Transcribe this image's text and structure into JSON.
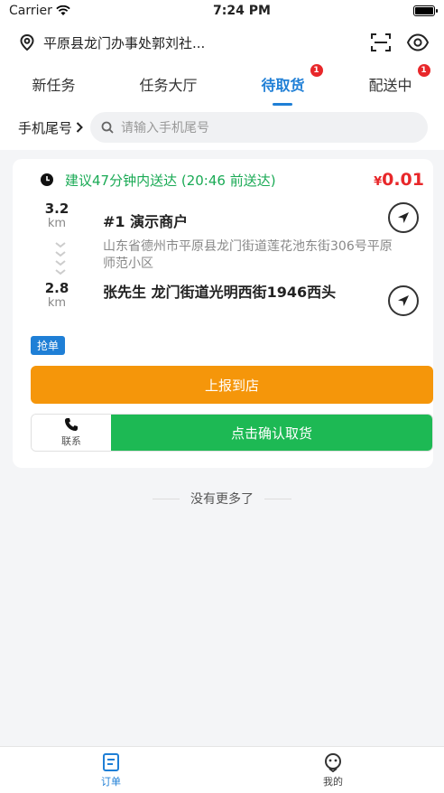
{
  "status_bar": {
    "carrier": "Carrier",
    "time": "7:24 PM"
  },
  "header": {
    "location": "平原县龙门办事处郭刘社...",
    "icons": [
      "location-pin-icon",
      "scan-icon",
      "eye-icon"
    ]
  },
  "tabs": [
    {
      "label": "新任务",
      "active": false
    },
    {
      "label": "任务大厅",
      "active": false
    },
    {
      "label": "待取货",
      "active": true,
      "badge": "1"
    },
    {
      "label": "配送中",
      "active": false,
      "badge": "1"
    }
  ],
  "filter": {
    "label": "手机尾号",
    "placeholder": "请输入手机尾号"
  },
  "order": {
    "eta_text": "建议47分钟内送达 (20:46 前送达)",
    "price_symbol": "¥",
    "price": "0.01",
    "pickup_distance": "3.2",
    "dropoff_distance": "2.8",
    "distance_unit": "km",
    "shop_name": "#1 演示商户",
    "shop_address": "山东省德州市平原县龙门街道莲花池东街306号平原师范小区",
    "customer": "张先生 龙门街道光明西街1946西头",
    "tag": "抢单",
    "report_button": "上报到店",
    "contact_label": "联系",
    "confirm_button": "点击确认取货"
  },
  "no_more": "没有更多了",
  "bottom_nav": [
    {
      "label": "订单",
      "active": true,
      "icon": "order-icon"
    },
    {
      "label": "我的",
      "active": false,
      "icon": "profile-icon"
    }
  ],
  "colors": {
    "accent": "#1f7fd6",
    "green": "#1aaa55",
    "orange": "#f5960a",
    "red": "#e8272a"
  }
}
